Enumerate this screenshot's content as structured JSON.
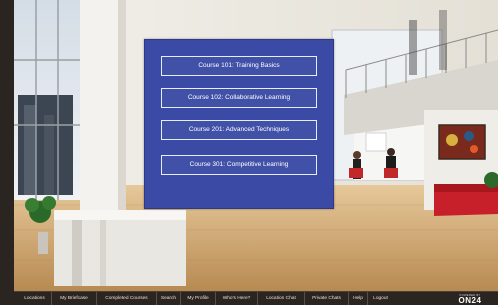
{
  "courses": [
    {
      "label": "Course 101: Training Basics"
    },
    {
      "label": "Course 102: Collaborative Learning"
    },
    {
      "label": "Course 201: Advanced Techniques"
    },
    {
      "label": "Course 301: Competitive Learning"
    }
  ],
  "nav": {
    "items": [
      {
        "label": "Locations"
      },
      {
        "label": "My Briefcase"
      },
      {
        "label": "Completed Courses"
      },
      {
        "label": "Search"
      },
      {
        "label": "My Profile"
      },
      {
        "label": "Who's Here?"
      },
      {
        "label": "Location Chat"
      },
      {
        "label": "Private Chats"
      },
      {
        "label": "Help"
      },
      {
        "label": "Logout"
      }
    ]
  },
  "brand": {
    "top": "POWERED BY",
    "name": "ON24"
  },
  "colors": {
    "panel": "#3b4aa5",
    "navbar": "#2a2520",
    "nav_text": "#e8e0d0"
  },
  "icons": {
    "logo": "on24-logo"
  }
}
